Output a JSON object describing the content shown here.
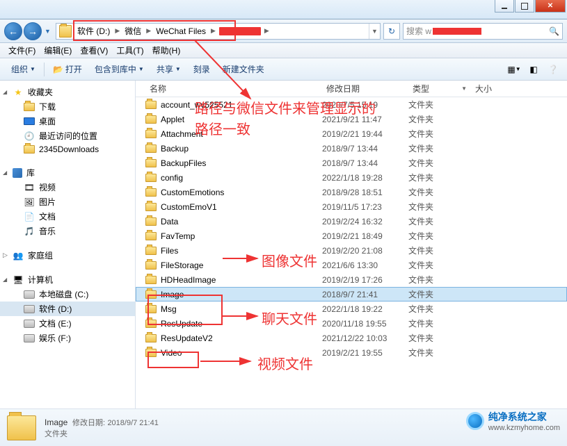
{
  "breadcrumb": {
    "items": [
      "软件 (D:)",
      "微信",
      "WeChat Files"
    ],
    "redacted_tail": true
  },
  "search": {
    "prefix": "搜索 w",
    "placeholder_redacted": true
  },
  "menubar": [
    {
      "label": "文件(F)"
    },
    {
      "label": "编辑(E)"
    },
    {
      "label": "查看(V)"
    },
    {
      "label": "工具(T)"
    },
    {
      "label": "帮助(H)"
    }
  ],
  "toolbar": {
    "organize": "组织",
    "open": "打开",
    "include": "包含到库中",
    "share": "共享",
    "burn": "刻录",
    "new_folder": "新建文件夹"
  },
  "nav": {
    "favorites": {
      "label": "收藏夹",
      "items": [
        "下载",
        "桌面",
        "最近访问的位置",
        "2345Downloads"
      ]
    },
    "libraries": {
      "label": "库",
      "items": [
        "视频",
        "图片",
        "文档",
        "音乐"
      ]
    },
    "homegroup": {
      "label": "家庭组"
    },
    "computer": {
      "label": "计算机",
      "items": [
        "本地磁盘 (C:)",
        "软件 (D:)",
        "文档 (E:)",
        "娱乐 (F:)"
      ],
      "selected_index": 1
    }
  },
  "columns": {
    "name": "名称",
    "date": "修改日期",
    "type": "类型",
    "size": "大小"
  },
  "files": [
    {
      "name": "account_wv525521",
      "date": "2020/7/5 15:19",
      "type": "文件夹",
      "partial_redact": true
    },
    {
      "name": "Applet",
      "date": "2021/9/21 11:47",
      "type": "文件夹"
    },
    {
      "name": "Attachment",
      "date": "2019/2/21 19:44",
      "type": "文件夹"
    },
    {
      "name": "Backup",
      "date": "2018/9/7 13:44",
      "type": "文件夹"
    },
    {
      "name": "BackupFiles",
      "date": "2018/9/7 13:44",
      "type": "文件夹"
    },
    {
      "name": "config",
      "date": "2022/1/18 19:28",
      "type": "文件夹"
    },
    {
      "name": "CustomEmotions",
      "date": "2018/9/28 18:51",
      "type": "文件夹"
    },
    {
      "name": "CustomEmoV1",
      "date": "2019/11/5 17:23",
      "type": "文件夹"
    },
    {
      "name": "Data",
      "date": "2019/2/24 16:32",
      "type": "文件夹"
    },
    {
      "name": "FavTemp",
      "date": "2019/2/21 18:49",
      "type": "文件夹"
    },
    {
      "name": "Files",
      "date": "2019/2/20 21:08",
      "type": "文件夹"
    },
    {
      "name": "FileStorage",
      "date": "2021/6/6 13:30",
      "type": "文件夹"
    },
    {
      "name": "HDHeadImage",
      "date": "2019/2/19 17:26",
      "type": "文件夹"
    },
    {
      "name": "Image",
      "date": "2018/9/7 21:41",
      "type": "文件夹",
      "selected": true
    },
    {
      "name": "Msg",
      "date": "2022/1/18 19:22",
      "type": "文件夹"
    },
    {
      "name": "ResUpdate",
      "date": "2020/11/18 19:55",
      "type": "文件夹"
    },
    {
      "name": "ResUpdateV2",
      "date": "2021/12/22 10:03",
      "type": "文件夹"
    },
    {
      "name": "Video",
      "date": "2019/2/21 19:55",
      "type": "文件夹"
    }
  ],
  "details": {
    "name": "Image",
    "date_label": "修改日期:",
    "date": "2018/9/7 21:41",
    "type": "文件夹"
  },
  "annotations": {
    "path_note": "路径与微信文件来管理显示的",
    "path_note2": "路径一致",
    "image_note": "图像文件",
    "chat_note": "聊天文件",
    "video_note": "视频文件"
  },
  "watermark": {
    "title": "纯净系统之家",
    "url": "www.kzmyhome.com"
  }
}
